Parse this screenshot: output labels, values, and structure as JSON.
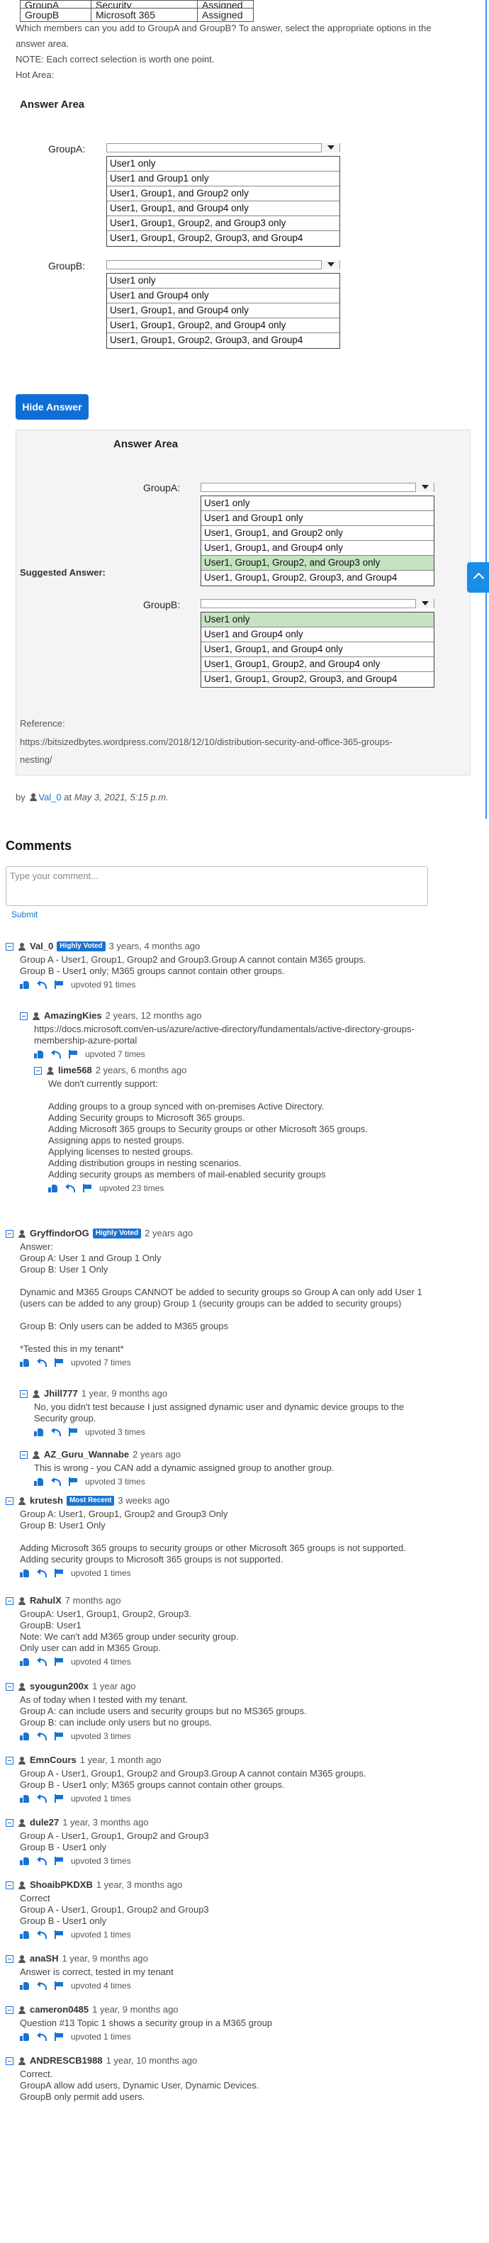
{
  "question": {
    "table_rows": [
      [
        "GroupA",
        "Security",
        "Assigned"
      ],
      [
        "GroupB",
        "Microsoft 365",
        "Assigned"
      ]
    ],
    "prompt_line1": "Which members can you add to GroupA and GroupB? To answer, select the appropriate options in the",
    "prompt_line2": "answer area.",
    "note": "NOTE: Each correct selection is worth one point.",
    "hot_area": "Hot Area:"
  },
  "answer_area": {
    "title": "Answer Area",
    "groupA_label": "GroupA:",
    "groupB_label": "GroupB:",
    "groupA_options": [
      "User1 only",
      "User1 and Group1 only",
      "User1, Group1, and Group2 only",
      "User1, Group1, and Group4 only",
      "User1, Group1, Group2, and Group3 only",
      "User1, Group1, Group2, Group3, and Group4"
    ],
    "groupB_options": [
      "User1 only",
      "User1 and Group4 only",
      "User1, Group1, and Group4 only",
      "User1, Group1, Group2, and Group4 only",
      "User1, Group1, Group2, Group3, and Group4"
    ]
  },
  "hide_answer_label": "Hide Answer",
  "suggested": {
    "label": "Suggested Answer:",
    "title": "Answer Area",
    "groupA_label": "GroupA:",
    "groupB_label": "GroupB:",
    "groupA_selected": "User1, Group1, Group2, and Group3 only",
    "groupB_selected": "User1 only",
    "reference_label": "Reference:",
    "reference_line1": "https://bitsizedbytes.wordpress.com/2018/12/10/distribution-security-and-office-365-groups-",
    "reference_line2": "nesting/"
  },
  "byline": {
    "prefix": "by",
    "user": "Val_0",
    "at": "at",
    "date": "May 3, 2021, 5:15 p.m."
  },
  "comments_heading": "Comments",
  "comment_input_placeholder": "Type your comment...",
  "submit_label": "Submit",
  "comments": [
    {
      "user": "Val_0",
      "badge": "Highly Voted",
      "time": "3 years, 4 months ago",
      "body": "Group A - User1, Group1, Group2 and Group3.Group A cannot contain M365 groups.\nGroup B - User1 only; M365 groups cannot contain other groups.",
      "votes": "upvoted 91 times"
    },
    {
      "user": "AmazingKies",
      "badge": "",
      "time": "2 years, 12 months ago",
      "body": "https://docs.microsoft.com/en-us/azure/active-directory/fundamentals/active-directory-groups-\nmembership-azure-portal",
      "votes": "upvoted 7 times"
    },
    {
      "user": "lime568",
      "badge": "",
      "time": "2 years, 6 months ago",
      "body": "We don't currently support:\n\nAdding groups to a group synced with on-premises Active Directory.\nAdding Security groups to Microsoft 365 groups.\nAdding Microsoft 365 groups to Security groups or other Microsoft 365 groups.\nAssigning apps to nested groups.\nApplying licenses to nested groups.\nAdding distribution groups in nesting scenarios.\nAdding security groups as members of mail-enabled security groups",
      "votes": "upvoted 23 times"
    },
    {
      "user": "GryffindorOG",
      "badge": "Highly Voted",
      "time": "2 years ago",
      "body": "Answer:\nGroup A: User 1 and Group 1 Only\nGroup B: User 1 Only\n\nDynamic and M365 Groups CANNOT be added to security groups so Group A can only add User 1\n(users can be added to any group) Group 1 (security groups can be added to security groups)\n\nGroup B: Only users can be added to M365 groups\n\n*Tested this in my tenant*",
      "votes": "upvoted 7 times"
    },
    {
      "user": "Jhill777",
      "badge": "",
      "time": "1 year, 9 months ago",
      "body": "No, you didn't test because I just assigned dynamic user and dynamic device groups to the\nSecurity group.",
      "votes": "upvoted 3 times"
    },
    {
      "user": "AZ_Guru_Wannabe",
      "badge": "",
      "time": "2 years ago",
      "body": "This is wrong - you CAN add a dynamic assigned group to another group.",
      "votes": "upvoted 3 times"
    },
    {
      "user": "krutesh",
      "badge": "Most Recent",
      "time": "3 weeks ago",
      "body": "Group A: User1, Group1, Group2 and Group3 Only\nGroup B: User1 Only\n\nAdding Microsoft 365 groups to security groups or other Microsoft 365 groups is not supported.\nAdding security groups to Microsoft 365 groups is not supported.",
      "votes": "upvoted 1 times"
    },
    {
      "user": "RahulX",
      "badge": "",
      "time": "7 months ago",
      "body": "GroupA: User1, Group1, Group2, Group3.\nGroupB: User1\nNote: We can't add M365 group under security group.\nOnly user can add in M365 Group.",
      "votes": "upvoted 4 times"
    },
    {
      "user": "syougun200x",
      "badge": "",
      "time": "1 year ago",
      "body": "As of today when I tested with my tenant.\nGroup A: can include users and security groups but no MS365 groups.\nGroup B: can include only users but no groups.",
      "votes": "upvoted 3 times"
    },
    {
      "user": "EmnCours",
      "badge": "",
      "time": "1 year, 1 month ago",
      "body": "Group A - User1, Group1, Group2 and Group3.Group A cannot contain M365 groups.\nGroup B - User1 only; M365 groups cannot contain other groups.",
      "votes": "upvoted 1 times"
    },
    {
      "user": "dule27",
      "badge": "",
      "time": "1 year, 3 months ago",
      "body": "Group A - User1, Group1, Group2 and Group3\nGroup B - User1 only",
      "votes": "upvoted 3 times"
    },
    {
      "user": "ShoaibPKDXB",
      "badge": "",
      "time": "1 year, 3 months ago",
      "body": "Correct\nGroup A - User1, Group1, Group2 and Group3\nGroup B - User1 only",
      "votes": "upvoted 1 times"
    },
    {
      "user": "anaSH",
      "badge": "",
      "time": "1 year, 9 months ago",
      "body": "Answer is correct, tested in my tenant",
      "votes": "upvoted 4 times"
    },
    {
      "user": "cameron0485",
      "badge": "",
      "time": "1 year, 9 months ago",
      "body": "Question #13 Topic 1 shows a security group in a M365 group",
      "votes": "upvoted 1 times"
    },
    {
      "user": "ANDRESCB1988",
      "badge": "",
      "time": "1 year, 10 months ago",
      "body": "Correct.\nGroupA allow add users, Dynamic User, Dynamic Devices.\nGroupB only permit add users.",
      "votes": ""
    }
  ]
}
